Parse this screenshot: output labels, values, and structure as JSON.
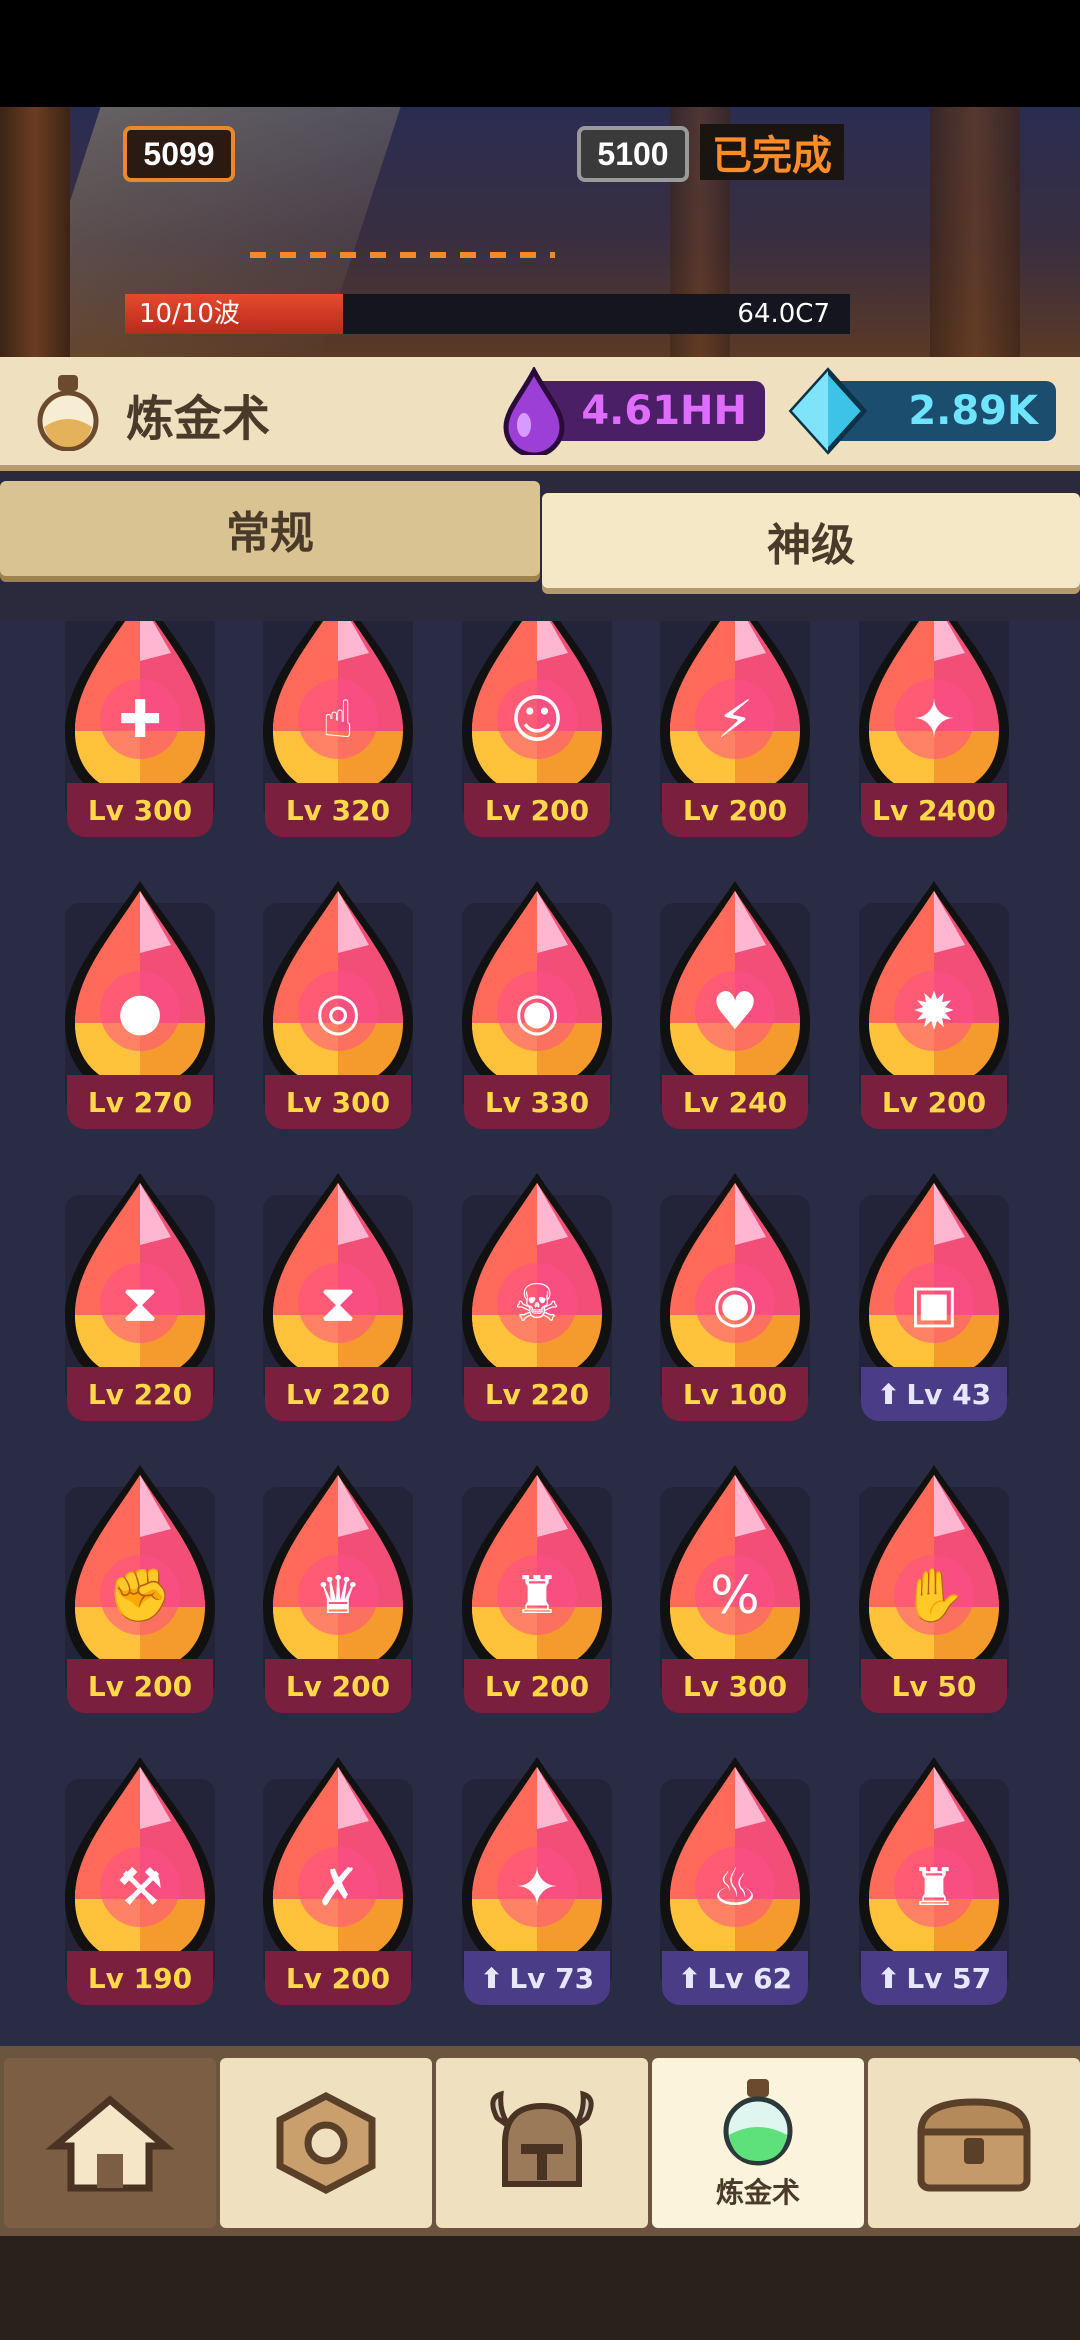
{
  "battle": {
    "current_stage": "5099",
    "next_stage": "5100",
    "status": "已完成",
    "wave_text": "10/10波",
    "wave_progress": 0.3,
    "dps": "64.0C7"
  },
  "header": {
    "title": "炼金术",
    "purple_currency": "4.61HH",
    "gem_currency": "2.89K"
  },
  "tabs": [
    {
      "label": "常规"
    },
    {
      "label": "神级"
    }
  ],
  "potions": [
    {
      "icon": "heart-dice-icon",
      "level": "Lv 300",
      "upgradable": false
    },
    {
      "icon": "tap-finger-icon",
      "level": "Lv 320",
      "upgradable": false
    },
    {
      "icon": "goblin-head-icon",
      "level": "Lv 200",
      "upgradable": false
    },
    {
      "icon": "lightning-flask-icon",
      "level": "Lv 200",
      "upgradable": false
    },
    {
      "icon": "sparkle-icon",
      "level": "Lv 2400",
      "upgradable": false
    },
    {
      "icon": "saturn-stone-icon",
      "level": "Lv 270",
      "upgradable": false
    },
    {
      "icon": "cracked-egg-icon",
      "level": "Lv 300",
      "upgradable": false
    },
    {
      "icon": "swirl-ring-icon",
      "level": "Lv 330",
      "upgradable": false
    },
    {
      "icon": "heart-diamond-icon",
      "level": "Lv 240",
      "upgradable": false
    },
    {
      "icon": "fist-burst-icon",
      "level": "Lv 200",
      "upgradable": false
    },
    {
      "icon": "hourglass-bell-icon",
      "level": "Lv 220",
      "upgradable": false
    },
    {
      "icon": "hourglass-paw-icon",
      "level": "Lv 220",
      "upgradable": false
    },
    {
      "icon": "hourglass-skull-icon",
      "level": "Lv 220",
      "upgradable": false
    },
    {
      "icon": "eye-broken-heart-icon",
      "level": "Lv 100",
      "upgradable": false
    },
    {
      "icon": "spell-card-icon",
      "level": "Lv 43",
      "upgradable": true
    },
    {
      "icon": "fist-shield-icon",
      "level": "Lv 200",
      "upgradable": false
    },
    {
      "icon": "crown-shield-icon",
      "level": "Lv 200",
      "upgradable": false
    },
    {
      "icon": "castle-shield-icon",
      "level": "Lv 200",
      "upgradable": false
    },
    {
      "icon": "percent-scroll-icon",
      "level": "Lv 300",
      "upgradable": false
    },
    {
      "icon": "tombstone-hand-icon",
      "level": "Lv 50",
      "upgradable": false
    },
    {
      "icon": "pickaxe-heart-icon",
      "level": "Lv 190",
      "upgradable": false
    },
    {
      "icon": "poison-bottle-icon",
      "level": "Lv 200",
      "upgradable": false
    },
    {
      "icon": "sparkle-paw-icon",
      "level": "Lv 73",
      "upgradable": true
    },
    {
      "icon": "fire-paw-icon",
      "level": "Lv 62",
      "upgradable": true
    },
    {
      "icon": "castle-paw-icon",
      "level": "Lv 57",
      "upgradable": true
    }
  ],
  "nav": [
    {
      "icon": "home-icon",
      "label": ""
    },
    {
      "icon": "gear-nut-icon",
      "label": ""
    },
    {
      "icon": "viking-helmet-icon",
      "label": ""
    },
    {
      "icon": "potion-flask-icon",
      "label": "炼金术"
    },
    {
      "icon": "treasure-chest-icon",
      "label": ""
    }
  ]
}
